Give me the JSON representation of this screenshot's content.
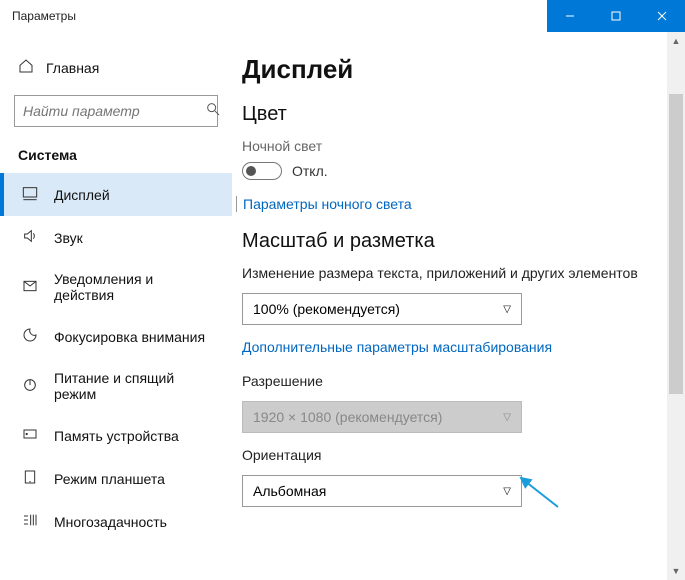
{
  "titlebar": {
    "title": "Параметры"
  },
  "sidebar": {
    "home": "Главная",
    "searchPlaceholder": "Найти параметр",
    "section": "Система",
    "items": [
      {
        "label": "Дисплей"
      },
      {
        "label": "Звук"
      },
      {
        "label": "Уведомления и действия"
      },
      {
        "label": "Фокусировка внимания"
      },
      {
        "label": "Питание и спящий режим"
      },
      {
        "label": "Память устройства"
      },
      {
        "label": "Режим планшета"
      },
      {
        "label": "Многозадачность"
      }
    ]
  },
  "main": {
    "heading": "Дисплей",
    "colorHeading": "Цвет",
    "nightLabel": "Ночной свет",
    "toggleState": "Откл.",
    "nightLink": "Параметры ночного света",
    "scaleHeading": "Масштаб и разметка",
    "scaleDesc": "Изменение размера текста, приложений и других элементов",
    "scaleValue": "100% (рекомендуется)",
    "scaleLink": "Дополнительные параметры масштабирования",
    "resLabel": "Разрешение",
    "resValue": "1920 × 1080 (рекомендуется)",
    "orientLabel": "Ориентация",
    "orientValue": "Альбомная"
  }
}
